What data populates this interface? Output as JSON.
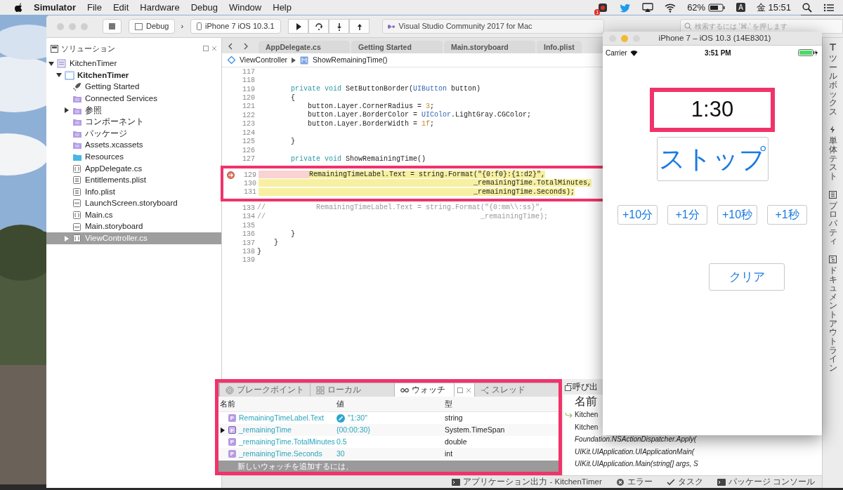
{
  "menu_bar": {
    "app": "Simulator",
    "menus": [
      "File",
      "Edit",
      "Hardware",
      "Debug",
      "Window",
      "Help"
    ],
    "notification_count": "1",
    "battery": "62%",
    "input_source": "A",
    "clock": "金 15:51"
  },
  "ide": {
    "toolbar": {
      "configuration": "Debug",
      "separator": "›",
      "device": "iPhone 7 iOS 10.3.1",
      "title": "Visual Studio Community 2017 for Mac",
      "search": {
        "placeholder": "検索するには '⌘.' を押します"
      }
    },
    "solution_pad": {
      "title": "ソリューション",
      "tree": [
        {
          "label": "KitchenTimer",
          "kind": "solution",
          "bold": false,
          "selected": false,
          "expanded": true,
          "children": [
            {
              "label": "KitchenTimer",
              "kind": "project",
              "bold": true,
              "selected": false,
              "expanded": true,
              "children": [
                {
                  "label": "Getting Started",
                  "kind": "rocket",
                  "bold": false,
                  "selected": false
                },
                {
                  "label": "Connected Services",
                  "kind": "purple-folder",
                  "bold": false,
                  "selected": false
                },
                {
                  "label": "参照",
                  "kind": "purple-folder",
                  "bold": false,
                  "selected": false,
                  "expanded": false
                },
                {
                  "label": "コンポーネント",
                  "kind": "purple-folder",
                  "bold": false,
                  "selected": false
                },
                {
                  "label": "パッケージ",
                  "kind": "purple-folder",
                  "bold": false,
                  "selected": false
                },
                {
                  "label": "Assets.xcassets",
                  "kind": "purple-folder",
                  "bold": false,
                  "selected": false
                },
                {
                  "label": "Resources",
                  "kind": "blue-folder",
                  "bold": false,
                  "selected": false
                },
                {
                  "label": "AppDelegate.cs",
                  "kind": "code-file",
                  "bold": false,
                  "selected": false
                },
                {
                  "label": "Entitlements.plist",
                  "kind": "plist-file",
                  "bold": false,
                  "selected": false
                },
                {
                  "label": "Info.plist",
                  "kind": "plist-file",
                  "bold": false,
                  "selected": false
                },
                {
                  "label": "LaunchScreen.storyboard",
                  "kind": "storyboard-file",
                  "bold": false,
                  "selected": false
                },
                {
                  "label": "Main.cs",
                  "kind": "code-file",
                  "bold": false,
                  "selected": false
                },
                {
                  "label": "Main.storyboard",
                  "kind": "storyboard-file",
                  "bold": false,
                  "selected": false
                },
                {
                  "label": "ViewController.cs",
                  "kind": "code-file",
                  "bold": false,
                  "selected": true,
                  "expanded": false
                }
              ]
            }
          ]
        }
      ]
    },
    "document_tabs": [
      {
        "label": "AppDelegate.cs",
        "selected": false
      },
      {
        "label": "Getting Started",
        "selected": false
      },
      {
        "label": "Main.storyboard",
        "selected": false
      },
      {
        "label": "Info.plist",
        "selected": false
      }
    ],
    "breadcrumb": [
      "ViewController",
      "ShowRemainingTime()"
    ],
    "code_lines": [
      {
        "number": "117",
        "breakpoint": false,
        "current": false,
        "highlighted": false
      },
      {
        "number": "118",
        "breakpoint": false,
        "current": false,
        "highlighted": false
      },
      {
        "number": "119",
        "breakpoint": false,
        "current": false,
        "highlighted": false,
        "tokens": [
          {
            "text": "        private void",
            "kind": "keyword"
          },
          {
            "text": " SetButtonBorder(",
            "kind": "plain"
          },
          {
            "text": "UIButton",
            "kind": "type"
          },
          {
            "text": " button)",
            "kind": "plain"
          }
        ]
      },
      {
        "number": "120",
        "breakpoint": false,
        "current": false,
        "highlighted": false,
        "tokens": [
          {
            "text": "        {",
            "kind": "plain"
          }
        ]
      },
      {
        "number": "121",
        "breakpoint": false,
        "current": false,
        "highlighted": false,
        "tokens": [
          {
            "text": "            button.Layer.CornerRadius = ",
            "kind": "plain"
          },
          {
            "text": "3",
            "kind": "number"
          },
          {
            "text": ";",
            "kind": "plain"
          }
        ]
      },
      {
        "number": "122",
        "breakpoint": false,
        "current": false,
        "highlighted": false,
        "tokens": [
          {
            "text": "            button.Layer.BorderColor = ",
            "kind": "plain"
          },
          {
            "text": "UIColor",
            "kind": "type"
          },
          {
            "text": ".LightGray.CGColor;",
            "kind": "plain"
          }
        ]
      },
      {
        "number": "123",
        "breakpoint": false,
        "current": false,
        "highlighted": false,
        "tokens": [
          {
            "text": "            button.Layer.BorderWidth = ",
            "kind": "plain"
          },
          {
            "text": "1f",
            "kind": "number"
          },
          {
            "text": ";",
            "kind": "plain"
          }
        ]
      },
      {
        "number": "124",
        "breakpoint": false,
        "current": false,
        "highlighted": false
      },
      {
        "number": "125",
        "breakpoint": false,
        "current": false,
        "highlighted": false,
        "tokens": [
          {
            "text": "        }",
            "kind": "plain"
          }
        ]
      },
      {
        "number": "126",
        "breakpoint": false,
        "current": false,
        "highlighted": false
      },
      {
        "number": "127",
        "breakpoint": false,
        "current": false,
        "highlighted": false,
        "tokens": [
          {
            "text": "        private void",
            "kind": "keyword"
          },
          {
            "text": " ShowRemainingTime()",
            "kind": "plain"
          }
        ]
      },
      {
        "number": "129",
        "breakpoint": true,
        "current": true,
        "highlighted": true,
        "tokens": [
          {
            "text": "            RemainingTimeLabel.Text = string.Format(\"{0:f0}:{1:d2}\",",
            "kind": "plain"
          }
        ]
      },
      {
        "number": "130",
        "breakpoint": false,
        "current": true,
        "highlighted": true,
        "tokens": [
          {
            "text": "                                                   _remainingTime.TotalMinutes,",
            "kind": "plain"
          }
        ]
      },
      {
        "number": "131",
        "breakpoint": false,
        "current": true,
        "highlighted": true,
        "tokens": [
          {
            "text": "                                                   _remainingTime.Seconds);",
            "kind": "plain"
          }
        ]
      },
      {
        "number": "133",
        "breakpoint": false,
        "current": false,
        "highlighted": false,
        "tokens": [
          {
            "text": "//            RemainingTimeLabel.Text = string.Format(\"{0:mm\\\\:ss}\",",
            "kind": "comment"
          }
        ]
      },
      {
        "number": "134",
        "breakpoint": false,
        "current": false,
        "highlighted": false,
        "tokens": [
          {
            "text": "//                                                   _remainingTime);",
            "kind": "comment"
          }
        ]
      },
      {
        "number": "135",
        "breakpoint": false,
        "current": false,
        "highlighted": false
      },
      {
        "number": "136",
        "breakpoint": false,
        "current": false,
        "highlighted": false,
        "tokens": [
          {
            "text": "        }",
            "kind": "plain"
          }
        ]
      },
      {
        "number": "137",
        "breakpoint": false,
        "current": false,
        "highlighted": false,
        "tokens": [
          {
            "text": "    }",
            "kind": "plain"
          }
        ]
      },
      {
        "number": "138",
        "breakpoint": false,
        "current": false,
        "highlighted": false,
        "tokens": [
          {
            "text": "}",
            "kind": "plain"
          }
        ]
      },
      {
        "number": "139",
        "breakpoint": false,
        "current": false,
        "highlighted": false
      }
    ],
    "watch_pad": {
      "highlighted": true,
      "tabs": [
        {
          "label": "ブレークポイント",
          "selected": false
        },
        {
          "label": "ローカル",
          "selected": false
        },
        {
          "label": "ウォッチ",
          "selected": true
        },
        {
          "label": "スレッド",
          "selected": false
        }
      ],
      "columns": [
        "名前",
        "値",
        "型"
      ],
      "rows": [
        {
          "badge": "P",
          "name": "RemainingTimeLabel.Text",
          "value": "\"1:30\"",
          "type": "string",
          "visualizer": true
        },
        {
          "badge": "F",
          "name": "_remainingTime",
          "value": "{00:00:30}",
          "type": "System.TimeSpan",
          "visualizer": false,
          "expanded": false
        },
        {
          "badge": "P",
          "name": "_remainingTime.TotalMinutes",
          "value": "0.5",
          "type": "double",
          "visualizer": false
        },
        {
          "badge": "P",
          "name": "_remainingTime.Seconds",
          "value": "30",
          "type": "int",
          "visualizer": false
        }
      ],
      "footer": "新しいウォッチを追加するには、"
    },
    "call_stack_pad": {
      "title": "呼び出",
      "columns": [
        "名前"
      ],
      "rows": [
        {
          "text": "Kitchen",
          "current": true,
          "external": false
        },
        {
          "text": "Kitchen",
          "current": false,
          "external": false
        },
        {
          "text": "Foundation.NSActionDispatcher.Apply(",
          "current": false,
          "external": true
        },
        {
          "text": "UIKit.UIApplication.UIApplicationMain(",
          "current": false,
          "external": true
        },
        {
          "text": "UIKit.UIApplication.Main(string[] args, S",
          "current": false,
          "external": true
        }
      ]
    },
    "status_bar": [
      {
        "label": "アプリケーション出力 - KitchenTimer",
        "kind": "terminal"
      },
      {
        "label": "エラー",
        "kind": "error"
      },
      {
        "label": "タスク",
        "kind": "check"
      },
      {
        "label": "パッケージ コンソール",
        "kind": "terminal"
      }
    ],
    "side_tabs": [
      {
        "label": "ツールボックス",
        "kind": "toolbox"
      },
      {
        "label": "単体テスト",
        "kind": "test"
      },
      {
        "label": "プロパティ",
        "kind": "properties"
      },
      {
        "label": "ドキュメントアウトライン",
        "kind": "outline"
      }
    ]
  },
  "simulator": {
    "title": "iPhone 7 – iOS 10.3 (14E8301)",
    "carrier": "Carrier",
    "time": "3:51 PM",
    "timer_label": "1:30",
    "timer_highlighted": true,
    "stop_button": "ストップ",
    "add_buttons": [
      "+10分",
      "+1分",
      "+10秒",
      "+1秒"
    ],
    "clear_button": "クリア"
  }
}
